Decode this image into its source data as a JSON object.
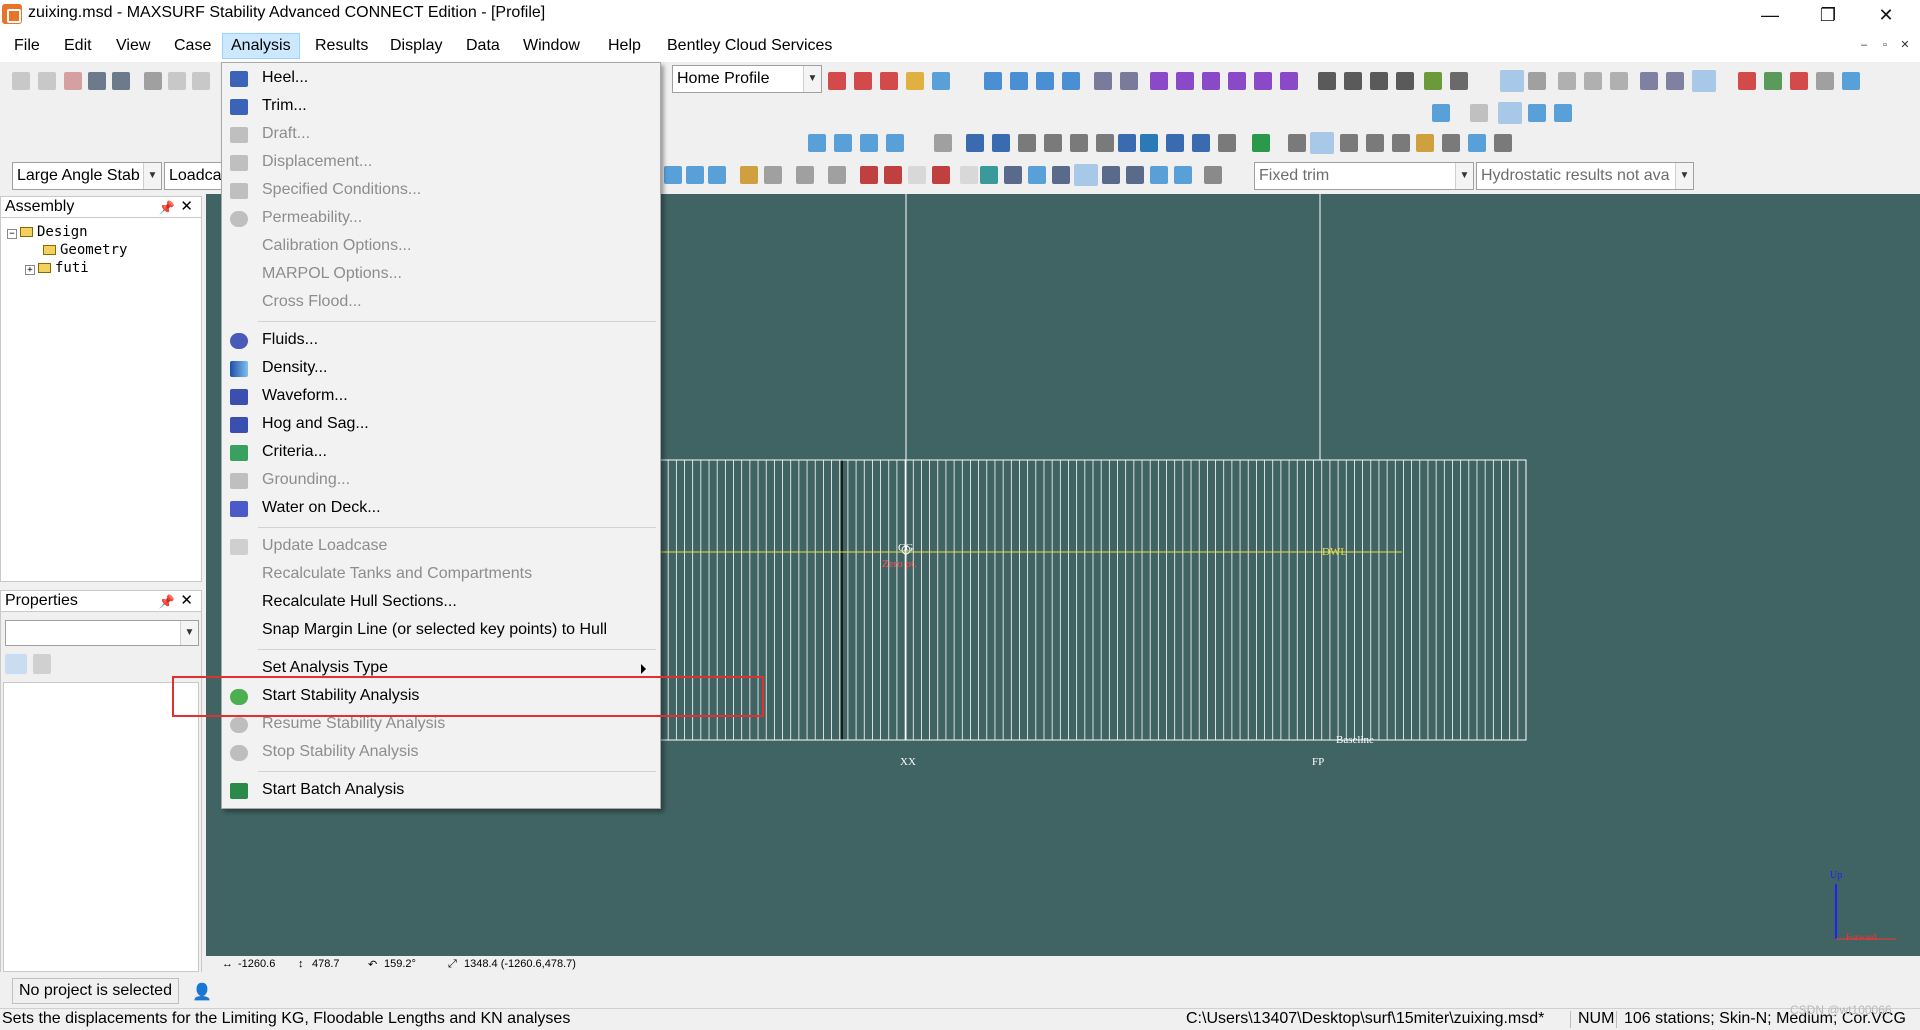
{
  "window": {
    "title": "zuixing.msd - MAXSURF Stability Advanced CONNECT Edition - [Profile]",
    "controls": [
      "—",
      "❐",
      "✕"
    ]
  },
  "menubar": {
    "items": [
      "File",
      "Edit",
      "View",
      "Case",
      "Analysis",
      "Results",
      "Display",
      "Data",
      "Window",
      "Help",
      "Bentley Cloud Services"
    ],
    "active": "Analysis",
    "mdi_controls": [
      "–",
      "▫",
      "✕"
    ]
  },
  "toolbar": {
    "view_combo": "Home Profile",
    "analysis_type_combo": "Large Angle Stab",
    "loadcase_combo": "Loadca",
    "trim_combo": "Fixed trim",
    "hydrostatic_combo": "Hydrostatic results not ava"
  },
  "assembly_panel": {
    "title": "Assembly",
    "pin": "📌",
    "close": "✕",
    "tree": [
      {
        "label": "Design",
        "expander": "−",
        "level": 0
      },
      {
        "label": "Geometry",
        "expander": "",
        "level": 1
      },
      {
        "label": "futi",
        "expander": "+",
        "level": 1
      }
    ]
  },
  "properties_panel": {
    "title": "Properties",
    "pin": "📌",
    "close": "✕",
    "combo_value": ""
  },
  "analysis_menu": {
    "items": [
      {
        "label": "Heel...",
        "enabled": true,
        "icon": "heel-icon"
      },
      {
        "label": "Trim...",
        "enabled": true,
        "icon": "trim-icon"
      },
      {
        "label": "Draft...",
        "enabled": false,
        "icon": "draft-icon"
      },
      {
        "label": "Displacement...",
        "enabled": false,
        "icon": "displacement-icon"
      },
      {
        "label": "Specified Conditions...",
        "enabled": false,
        "icon": "specified-conditions-icon"
      },
      {
        "label": "Permeability...",
        "enabled": false,
        "icon": "permeability-icon"
      },
      {
        "label": "Calibration Options...",
        "enabled": false,
        "icon": ""
      },
      {
        "label": "MARPOL Options...",
        "enabled": false,
        "icon": ""
      },
      {
        "label": "Cross Flood...",
        "enabled": false,
        "icon": ""
      },
      {
        "label": "Fluids...",
        "enabled": true,
        "icon": "fluids-icon"
      },
      {
        "label": "Density...",
        "enabled": true,
        "icon": "density-icon"
      },
      {
        "label": "Waveform...",
        "enabled": true,
        "icon": "waveform-icon"
      },
      {
        "label": "Hog and Sag...",
        "enabled": true,
        "icon": "hog-sag-icon"
      },
      {
        "label": "Criteria...",
        "enabled": true,
        "icon": "criteria-icon"
      },
      {
        "label": "Grounding...",
        "enabled": false,
        "icon": "grounding-icon"
      },
      {
        "label": "Water on Deck...",
        "enabled": true,
        "icon": "water-on-deck-icon"
      },
      {
        "label": "Update Loadcase",
        "enabled": false,
        "icon": "update-loadcase-icon"
      },
      {
        "label": "Recalculate Tanks and Compartments",
        "enabled": false,
        "icon": ""
      },
      {
        "label": "Recalculate Hull Sections...",
        "enabled": true,
        "icon": ""
      },
      {
        "label": "Snap Margin Line (or selected key points) to Hull",
        "enabled": true,
        "icon": ""
      },
      {
        "label": "Set Analysis Type",
        "enabled": true,
        "icon": ""
      },
      {
        "label": "Start Stability Analysis",
        "enabled": true,
        "icon": "play-icon"
      },
      {
        "label": "Resume Stability Analysis",
        "enabled": false,
        "icon": "resume-icon"
      },
      {
        "label": "Stop Stability Analysis",
        "enabled": false,
        "icon": "stop-icon"
      },
      {
        "label": "Start Batch Analysis",
        "enabled": true,
        "icon": "batch-icon"
      }
    ]
  },
  "viewport": {
    "labels": {
      "cg": "CG",
      "zero_pt": "Zero pt.",
      "dwl": "DWL",
      "baseline": "Baseline",
      "midship": "XX",
      "fp": "FP",
      "axis_up": "Up",
      "axis_fwd": "Forward"
    },
    "colors": {
      "background": "#406363",
      "dwl": "#e8e040",
      "zero_pt": "#ff5050",
      "axis": "#2020ff"
    }
  },
  "coords": {
    "x": "-1260.6",
    "y": "478.7",
    "angle": "159.2°",
    "distance": "1348.4 (-1260.6,478.7)"
  },
  "left_status": {
    "text": "No project is selected"
  },
  "statusbar": {
    "hint": "Sets the displacements for the Limiting KG, Floodable Lengths and KN analyses",
    "path": "C:\\Users\\13407\\Desktop\\surf\\15miter\\zuixing.msd*",
    "num": "NUM",
    "info": "106 stations; Skin-N; Medium; Cor.VCG",
    "watermark": "CSDN @wt100066"
  }
}
